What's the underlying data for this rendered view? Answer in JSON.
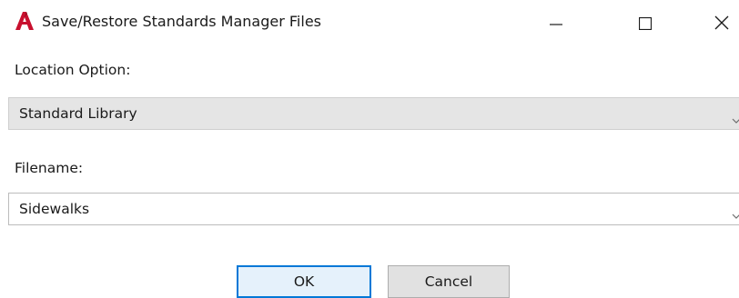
{
  "window": {
    "title": "Save/Restore Standards Manager Files",
    "app_icon": "autocad-a-icon",
    "accent_color": "#c8102e",
    "controls": {
      "minimize_icon": "minimize-icon",
      "maximize_icon": "maximize-icon",
      "close_icon": "close-icon"
    }
  },
  "form": {
    "location_label": "Location Option:",
    "location_value": "Standard Library",
    "filename_label": "Filename:",
    "filename_value": "Sidewalks",
    "dropdown_icon": "chevron-down-icon"
  },
  "buttons": {
    "ok_label": "OK",
    "cancel_label": "Cancel",
    "default_border_color": "#0078d7"
  }
}
